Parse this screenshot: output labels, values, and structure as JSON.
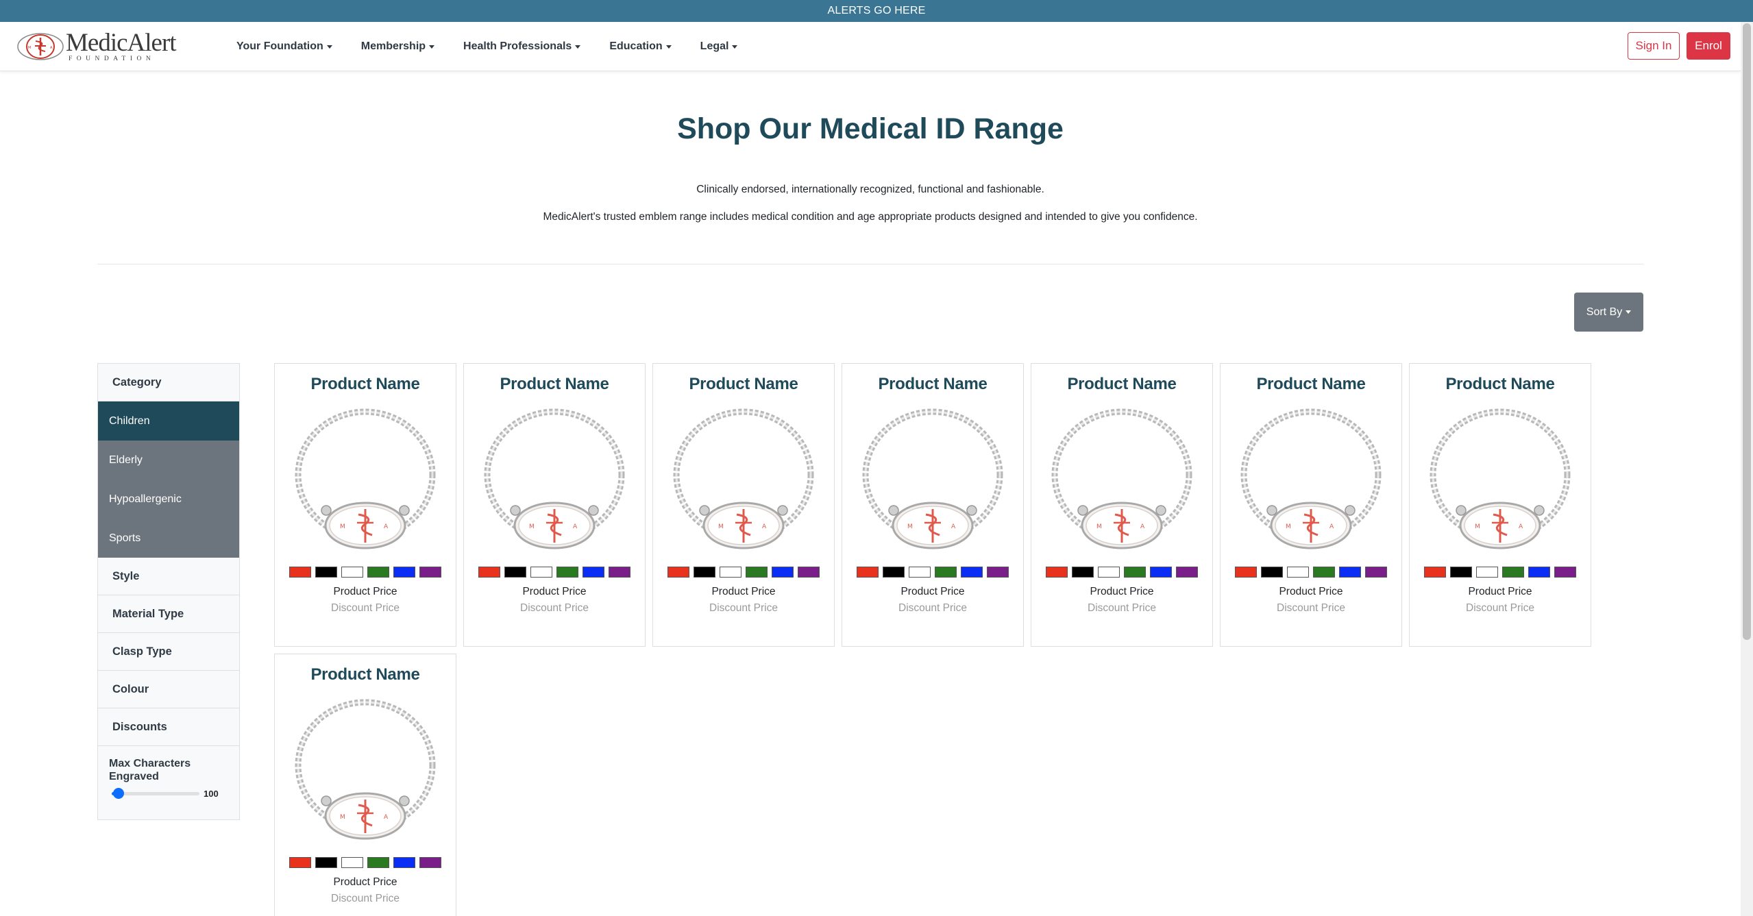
{
  "alert_bar": {
    "text": "ALERTS GO HERE"
  },
  "nav": {
    "logo_text": "MedicAlert",
    "logo_sub": "FOUNDATION",
    "items": [
      {
        "label": "Your Foundation"
      },
      {
        "label": "Membership"
      },
      {
        "label": "Health Professionals"
      },
      {
        "label": "Education"
      },
      {
        "label": "Legal"
      }
    ],
    "sign_in": "Sign In",
    "enrol": "Enrol"
  },
  "hero": {
    "title": "Shop Our Medical ID Range",
    "line1": "Clinically endorsed, internationally recognized, functional and fashionable.",
    "line2": "MedicAlert's trusted emblem range includes medical condition and age appropriate products designed and intended to give you confidence."
  },
  "sort": {
    "label": "Sort By"
  },
  "filters": {
    "category": "Category",
    "category_items": [
      {
        "label": "Children",
        "active": true
      },
      {
        "label": "Elderly",
        "active": false
      },
      {
        "label": "Hypoallergenic",
        "active": false
      },
      {
        "label": "Sports",
        "active": false
      }
    ],
    "style": "Style",
    "material": "Material Type",
    "clasp": "Clasp Type",
    "colour": "Colour",
    "discounts": "Discounts",
    "max_chars_label": "Max Characters Engraved",
    "max_chars_value": "100",
    "max_chars_fraction": 0.08
  },
  "swatch_colors": [
    "#e8321e",
    "#000000",
    "#ffffff",
    "#2a7a22",
    "#0a2ef5",
    "#7a1f8a"
  ],
  "product_image_icon": "medicalert-chain-bracelet",
  "products": [
    {
      "name": "Product Name",
      "price": "Product Price",
      "discount": "Discount Price"
    },
    {
      "name": "Product Name",
      "price": "Product Price",
      "discount": "Discount Price"
    },
    {
      "name": "Product Name",
      "price": "Product Price",
      "discount": "Discount Price"
    },
    {
      "name": "Product Name",
      "price": "Product Price",
      "discount": "Discount Price"
    },
    {
      "name": "Product Name",
      "price": "Product Price",
      "discount": "Discount Price"
    },
    {
      "name": "Product Name",
      "price": "Product Price",
      "discount": "Discount Price"
    },
    {
      "name": "Product Name",
      "price": "Product Price",
      "discount": "Discount Price"
    },
    {
      "name": "Product Name",
      "price": "Product Price",
      "discount": "Discount Price"
    }
  ]
}
